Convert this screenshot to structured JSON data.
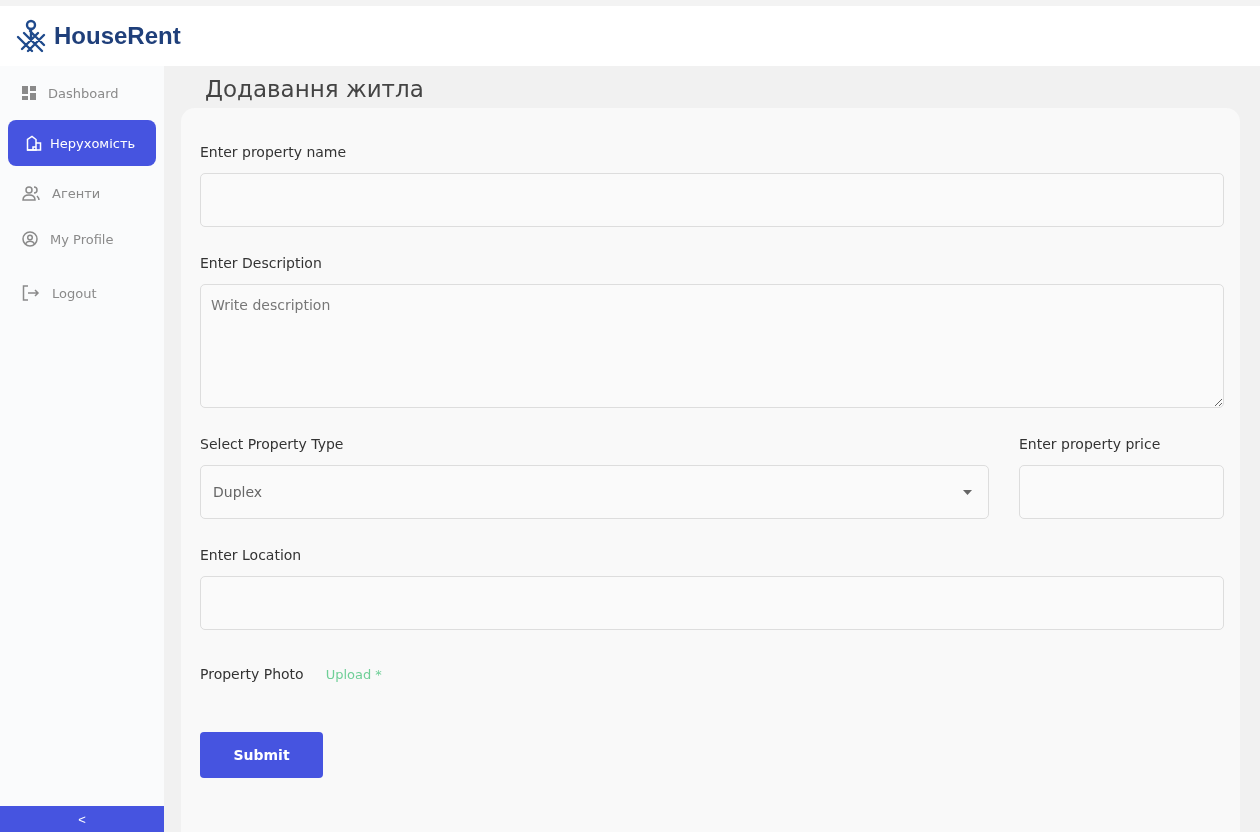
{
  "logo": {
    "name": "HouseRent"
  },
  "sidebar": {
    "items": [
      {
        "label": "Dashboard",
        "kind": "grid",
        "selected": false
      },
      {
        "label": "Нерухомість",
        "kind": "house",
        "selected": true
      },
      {
        "label": "Агенти",
        "kind": "people",
        "selected": false
      },
      {
        "label": "My Profile",
        "kind": "profile",
        "selected": false
      },
      {
        "label": "Logout",
        "kind": "logout",
        "selected": false
      }
    ],
    "collapse": "<"
  },
  "page_title": "Додавання житла",
  "form": {
    "rows": [
      {
        "fields": [
          {
            "kind": "text",
            "label": "Enter property name"
          }
        ]
      },
      {
        "fields": [
          {
            "kind": "textarea",
            "label": "Enter Description",
            "placeholder": "Write description"
          }
        ]
      },
      {
        "fields": [
          {
            "kind": "select",
            "label": "Select Property Type",
            "value": "Duplex"
          },
          {
            "kind": "text",
            "label": "Enter property price"
          }
        ]
      },
      {
        "fields": [
          {
            "kind": "text",
            "label": "Enter Location"
          }
        ]
      }
    ],
    "photo": {
      "label": "Property Photo",
      "link": "Upload *"
    },
    "submit": "Submit"
  }
}
